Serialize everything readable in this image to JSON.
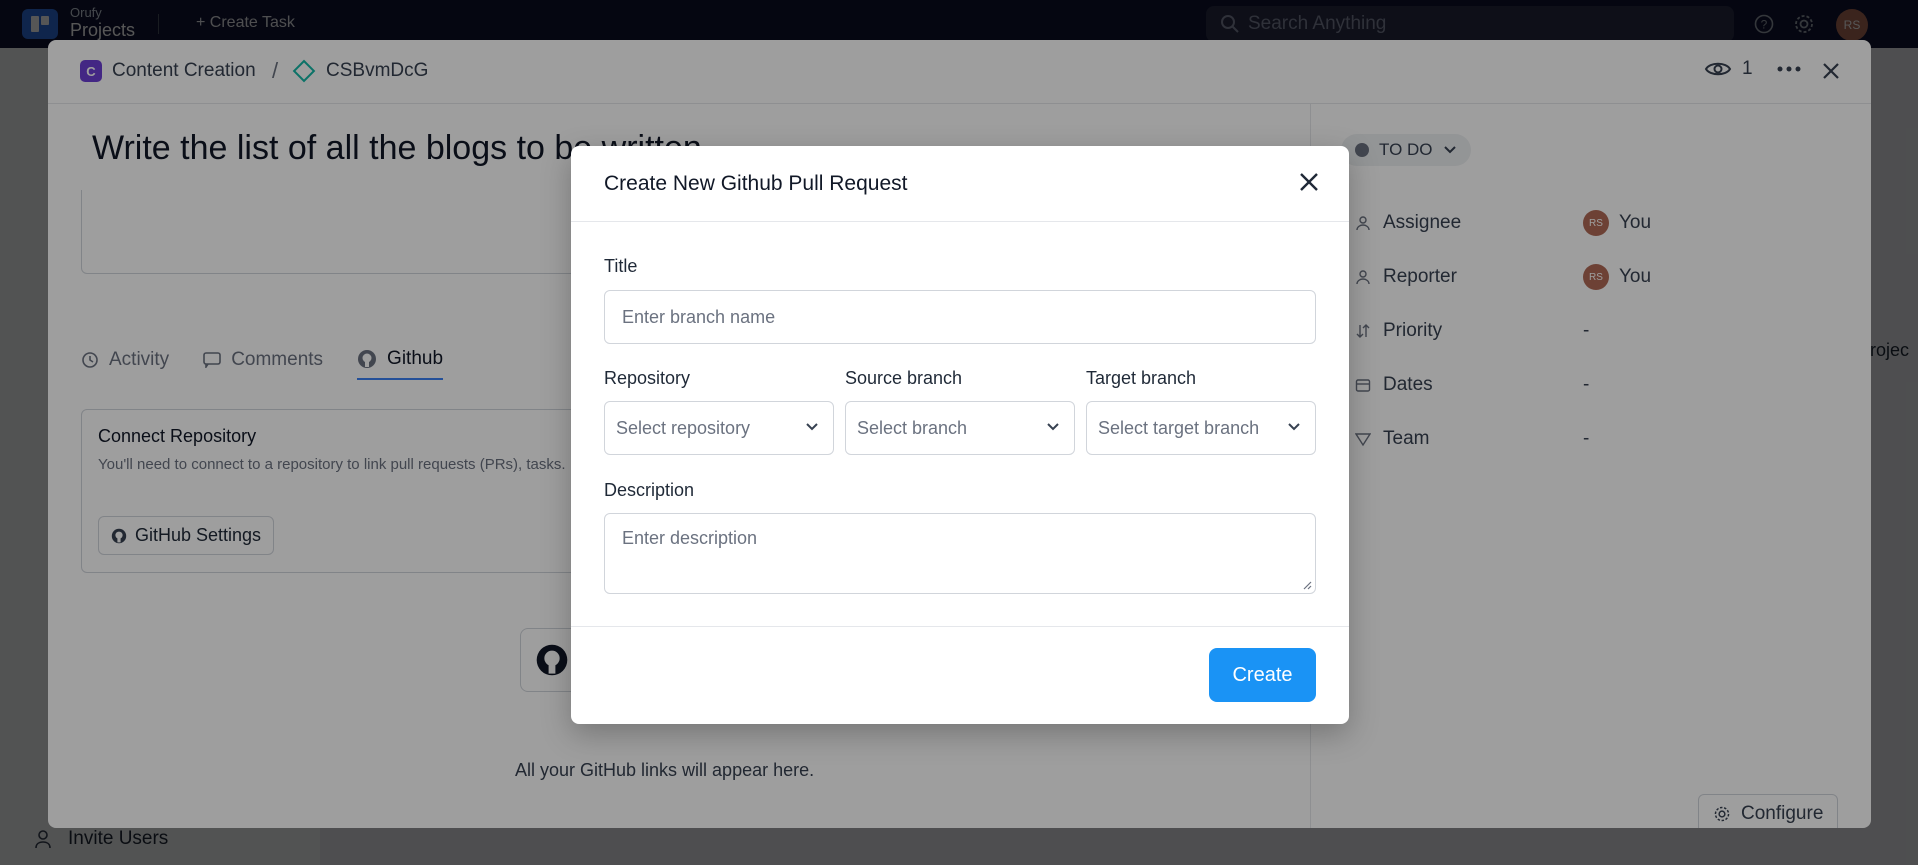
{
  "topbar": {
    "brand_small": "Orufy",
    "brand_big": "Projects",
    "create_task": "Create Task",
    "search_placeholder": "Search Anything",
    "avatar_initials": "RS"
  },
  "sidebar": {
    "invite_users": "Invite Users"
  },
  "background": {
    "right_text": "projec"
  },
  "task": {
    "breadcrumb_project": "Content Creation",
    "breadcrumb_project_initial": "C",
    "breadcrumb_separator": "/",
    "task_id": "CSBvmDcG",
    "watchers_count": "1",
    "title": "Write the list of all the blogs to be written",
    "tabs": [
      {
        "label": "Activity"
      },
      {
        "label": "Comments"
      },
      {
        "label": "Github"
      }
    ],
    "connect_title": "Connect Repository",
    "connect_text": "You'll need to connect to a repository to link pull requests (PRs), tasks.",
    "github_settings_label": "GitHub Settings",
    "github_links_text": "All your GitHub links will appear here."
  },
  "properties": {
    "status": "TO DO",
    "rows": [
      {
        "label": "Assignee",
        "value": "You",
        "avatar": "RS"
      },
      {
        "label": "Reporter",
        "value": "You",
        "avatar": "RS"
      },
      {
        "label": "Priority",
        "value": "-"
      },
      {
        "label": "Dates",
        "value": "-"
      },
      {
        "label": "Team",
        "value": "-"
      }
    ],
    "configure_label": "Configure"
  },
  "modal": {
    "title": "Create New Github Pull Request",
    "title_label": "Title",
    "title_placeholder": "Enter branch name",
    "repository_label": "Repository",
    "repository_placeholder": "Select repository",
    "source_label": "Source branch",
    "source_placeholder": "Select branch",
    "target_label": "Target branch",
    "target_placeholder": "Select target branch",
    "description_label": "Description",
    "description_placeholder": "Enter description",
    "create_label": "Create"
  },
  "colors": {
    "topbar_bg": "#111533",
    "accent_blue": "#1a93f5",
    "project_purple": "#6d3fd6",
    "task_teal": "#14b8a6"
  }
}
